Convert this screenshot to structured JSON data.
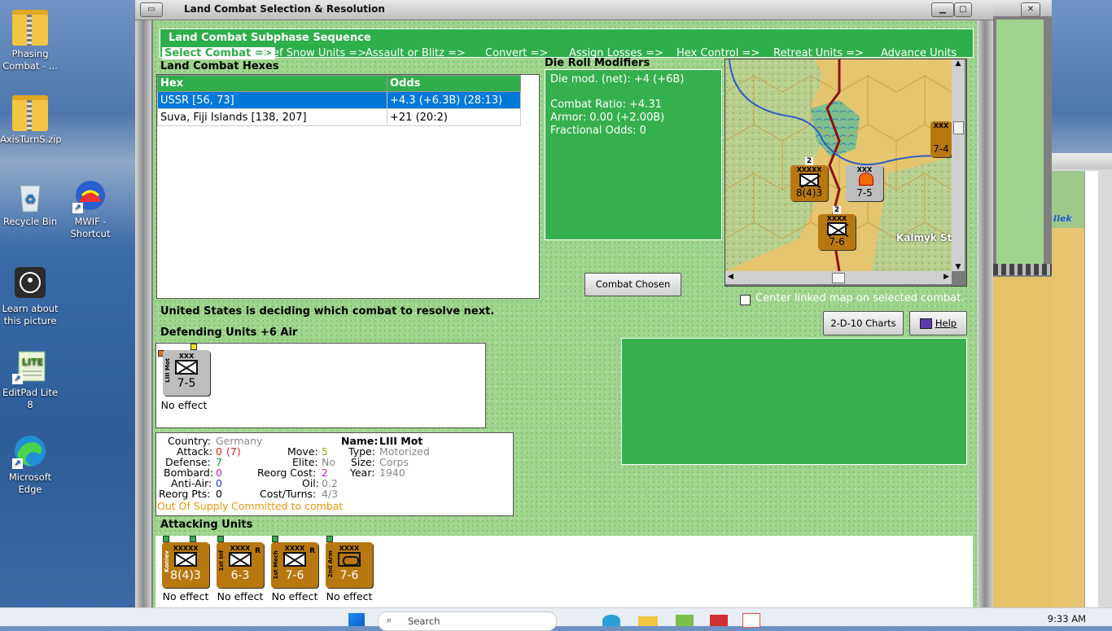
{
  "desktop": {
    "icons": [
      {
        "label": "Phasing Combat - ...",
        "icon": "zip-folder-icon"
      },
      {
        "label": "AxisTurnS.zip",
        "icon": "zip-folder-icon"
      },
      {
        "label": "Recycle Bin",
        "icon": "recycle-bin-icon"
      },
      {
        "label": "MWIF - Shortcut",
        "icon": "mwif-app-icon"
      },
      {
        "label": "Learn about this picture",
        "icon": "camera-icon"
      },
      {
        "label": "EditPad Lite 8",
        "icon": "editpad-icon"
      },
      {
        "label": "Microsoft Edge",
        "icon": "edge-icon"
      }
    ]
  },
  "window": {
    "title": "Land Combat Selection & Resolution",
    "phase_box_title": "Land Combat Subphase Sequence",
    "phases": [
      "Select Combat =>",
      "Def Snow Units =>",
      "Assault or Blitz =>",
      "Convert =>",
      "Assign Losses =>",
      "Hex Control =>",
      "Retreat Units =>",
      "Advance Units"
    ],
    "selected_phase": "Select Combat =>",
    "hexes_label": "Land Combat Hexes",
    "table_headers": [
      "Hex",
      "Odds"
    ],
    "table_rows": [
      {
        "hex": "USSR [56, 73]",
        "odds": "+4.3 (+6.3B) (28:13)",
        "selected": true
      },
      {
        "hex": "Suva, Fiji Islands [138, 207]",
        "odds": "+21 (20:2)",
        "selected": false
      }
    ],
    "die_roll_label": "Die Roll Modifiers",
    "die_roll": {
      "net": "Die mod. (net): +4 (+6B)",
      "combat_ratio": "Combat Ratio: +4.31",
      "armor": "Armor: 0.00 (+2.00B)",
      "fractional": "Fractional Odds: 0"
    },
    "combat_chosen_button": "Combat Chosen",
    "center_map_checkbox": "Center linked map on selected combat.",
    "charts_button": "2-D-10 Charts",
    "help_button": "Help",
    "status_message": "United States is deciding which combat to resolve next.",
    "defending_label": "Defending Units +6 Air",
    "defender": {
      "top": "XXX",
      "side": "LIII Mot",
      "value": "7-5",
      "effect": "No effect"
    },
    "unit_info": {
      "country_label": "Country:",
      "country": "Germany",
      "attack_label": "Attack:",
      "attack": "0",
      "attack_paren": "(7)",
      "defense_label": "Defense:",
      "defense": "7",
      "bombard_label": "Bombard:",
      "bombard": "0",
      "antiair_label": "Anti-Air:",
      "antiair": "0",
      "reorg_pts_label": "Reorg Pts:",
      "reorg_pts": "0",
      "move_label": "Move:",
      "move": "5",
      "elite_label": "Elite:",
      "elite": "No",
      "reorg_cost_label": "Reorg Cost:",
      "reorg_cost": "2",
      "oil_label": "Oil:",
      "oil": "0.2",
      "cost_turns_label": "Cost/Turns:",
      "cost_turns": "4/3",
      "name_label": "Name:",
      "name": "LIII Mot",
      "type_label": "Type:",
      "type": "Motorized",
      "size_label": "Size:",
      "size": "Corps",
      "year_label": "Year:",
      "year": "1940",
      "supply": "Out Of Supply",
      "committed": "Committed to combat"
    },
    "attacking_label": "Attacking Units",
    "attackers": [
      {
        "top": "XXXXX",
        "side": "Koniev",
        "value": "8(4)3",
        "effect": "No effect",
        "r": ""
      },
      {
        "top": "XXXX",
        "side": "1st Inf",
        "value": "6-3",
        "effect": "No effect",
        "r": "R"
      },
      {
        "top": "XXXX",
        "side": "1st Mech",
        "value": "7-6",
        "effect": "No effect",
        "r": "R"
      },
      {
        "top": "XXXX",
        "side": "2nd Arm",
        "value": "7-6",
        "effect": "No effect",
        "r": ""
      }
    ],
    "map": {
      "place_label": "Kalmyk Ste",
      "units": [
        {
          "top": "XXXXX",
          "value": "8(4)3",
          "stack": "2"
        },
        {
          "top": "XXX",
          "value": "7-5",
          "stack": ""
        },
        {
          "top": "XXXX",
          "value": "7-6",
          "stack": "2"
        },
        {
          "top": "XXX",
          "value": "7-4",
          "stack": ""
        }
      ]
    }
  },
  "side_map": {
    "place_label": "Ilek"
  },
  "taskbar": {
    "search_placeholder": "Search",
    "time": "9:33 AM"
  },
  "colors": {
    "panel_green": "#36b04f",
    "counter_brown": "#b8780f",
    "german_grey": "#bdbdbd",
    "selection_blue": "#0078d7"
  }
}
